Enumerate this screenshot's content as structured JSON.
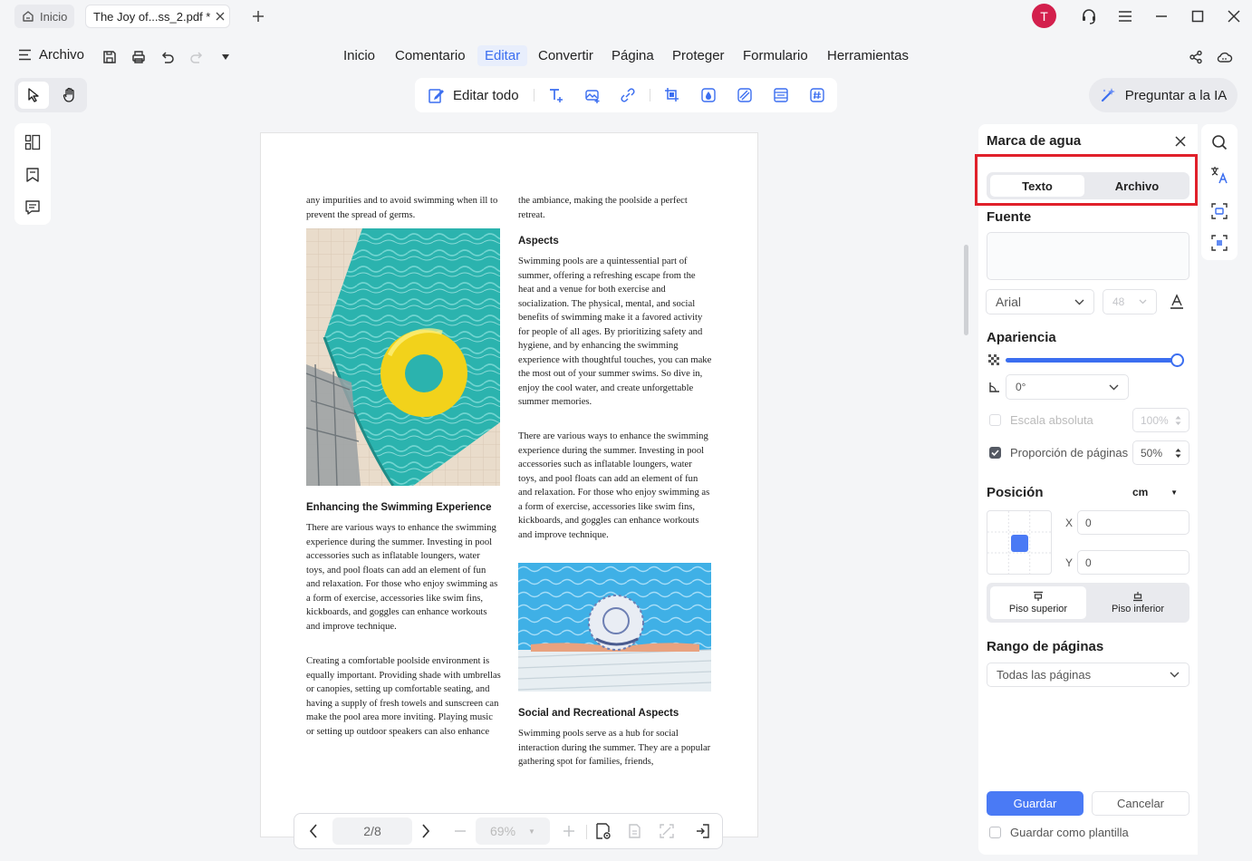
{
  "tabs": {
    "home": "Inicio",
    "document": "The Joy of...ss_2.pdf *"
  },
  "user": {
    "avatar_letter": "T",
    "avatar_color": "#d3204d"
  },
  "menu": {
    "archivo": "Archivo",
    "items": [
      "Inicio",
      "Comentario",
      "Editar",
      "Convertir",
      "Página",
      "Proteger",
      "Formulario",
      "Herramientas"
    ],
    "active": "Editar"
  },
  "edit_toolbar": {
    "edit_all": "Editar todo"
  },
  "ask_ai": "Preguntar a la IA",
  "accent_color": "#3b6ef0",
  "document": {
    "col1_top": "any impurities and to avoid swimming when ill to prevent the spread of germs.",
    "heading_enhancing": "Enhancing the Swimming Experience",
    "col1_p1": "There are various ways to enhance the swimming experience during the summer. Investing in pool accessories such as inflatable loungers, water toys, and pool floats can add an element of fun and relaxation. For those who enjoy swimming as a form of exercise, accessories like swim fins, kickboards, and goggles can enhance workouts and improve technique.",
    "col1_p2": "Creating a comfortable poolside environment is equally important. Providing shade with umbrellas or canopies, setting up comfortable seating, and having a supply of fresh towels and sunscreen can make the pool area more inviting. Playing music or setting up outdoor speakers can also enhance",
    "col2_top": "the ambiance, making the poolside a perfect retreat.",
    "heading_aspects": "Aspects",
    "col2_p1": "Swimming pools are a quintessential part of summer, offering a refreshing escape from the heat and a venue for both exercise and socialization. The physical, mental, and social benefits of swimming make it a favored activity for people of all ages. By prioritizing safety and hygiene, and by enhancing the swimming experience with thoughtful touches, you can make the most out of your summer swims. So dive in, enjoy the cool water, and create unforgettable summer memories.",
    "col2_p2": "There are various ways to enhance the swimming experience during the summer. Investing in pool accessories such as inflatable loungers, water toys, and pool floats can add an element of fun and relaxation. For those who enjoy swimming as a form of exercise, accessories like swim fins, kickboards, and goggles can enhance workouts and improve technique.",
    "heading_social": "Social and Recreational Aspects",
    "col2_p3": "Swimming pools serve as a hub for social interaction during the summer. They are a popular gathering spot for families, friends,"
  },
  "bottom_nav": {
    "page": "2/8",
    "zoom": "69%"
  },
  "panel": {
    "title": "Marca de agua",
    "tabs": [
      "Texto",
      "Archivo"
    ],
    "active_tab": "Texto",
    "highlight_color": "#e0202a",
    "font_label": "Fuente",
    "font_value": "Arial",
    "font_size": "48",
    "appearance_label": "Apariencia",
    "opacity_percent": 100,
    "rotation": "0°",
    "absolute_scale_label": "Escala absoluta",
    "absolute_scale_value": "100%",
    "page_ratio_label": "Proporción de páginas",
    "page_ratio_value": "50%",
    "position_label": "Posición",
    "unit": "cm",
    "x_label": "X",
    "x_value": "0",
    "y_label": "Y",
    "y_value": "0",
    "layer_top": "Piso superior",
    "layer_bottom": "Piso inferior",
    "page_range_label": "Rango de páginas",
    "page_range_value": "Todas las páginas",
    "save": "Guardar",
    "cancel": "Cancelar",
    "save_template": "Guardar como plantilla"
  }
}
